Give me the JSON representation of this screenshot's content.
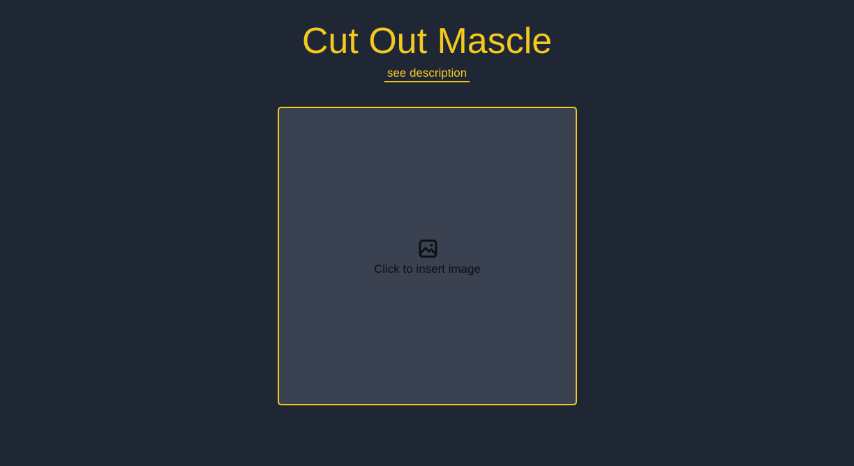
{
  "header": {
    "title": "Cut Out Mascle",
    "description_link": "see description"
  },
  "dropzone": {
    "label": "Click to insert image",
    "icon": "image-icon"
  },
  "colors": {
    "background": "#1f2734",
    "accent": "#f5c81f",
    "dropzone_fill": "#3a4252",
    "dropzone_text": "#0d0f14"
  }
}
